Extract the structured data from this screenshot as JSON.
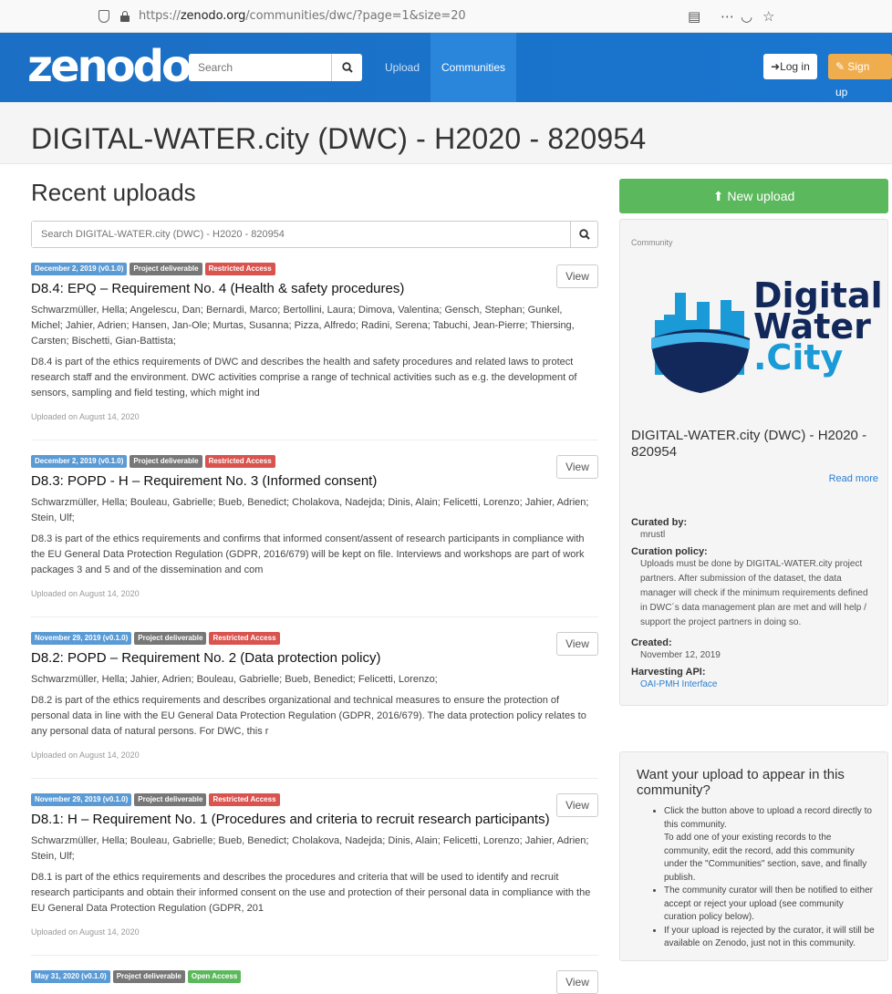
{
  "browser": {
    "url_prefix": "https://",
    "url_domain": "zenodo.org",
    "url_path": "/communities/dwc/?page=1&size=20"
  },
  "header": {
    "logo": "zenodo",
    "search_placeholder": "Search",
    "nav_upload": "Upload",
    "nav_communities": "Communities",
    "login": "Log in",
    "signup": "Sign up"
  },
  "page_title": "DIGITAL-WATER.city (DWC) - H2020 - 820954",
  "main": {
    "heading": "Recent uploads",
    "search_placeholder": "Search DIGITAL-WATER.city (DWC) - H2020 - 820954",
    "view_label": "View",
    "records": [
      {
        "date_badge": "December 2, 2019 (v0.1.0)",
        "type_badge": "Project deliverable",
        "access_badge": "Restricted Access",
        "title": "D8.4: EPQ – Requirement No. 4 (Health & safety procedures)",
        "authors": "Schwarzmüller, Hella; Angelescu, Dan; Bernardi, Marco; Bertollini, Laura; Dimova, Valentina; Gensch, Stephan; Gunkel, Michel; Jahier, Adrien; Hansen, Jan-Ole; Murtas, Susanna; Pizza, Alfredo; Radini, Serena; Tabuchi, Jean-Pierre; Thiersing, Carsten; Bischetti, Gian-Battista;",
        "description": "D8.4 is part of the ethics requirements of DWC and describes the health and safety procedures and related laws to protect research staff and the environment. DWC activities comprise a range of technical activities such as e.g. the development of sensors, sampling and field testing, which might ind",
        "uploaded": "Uploaded on August 14, 2020"
      },
      {
        "date_badge": "December 2, 2019 (v0.1.0)",
        "type_badge": "Project deliverable",
        "access_badge": "Restricted Access",
        "title": "D8.3: POPD - H – Requirement No. 3 (Informed consent)",
        "authors": "Schwarzmüller, Hella; Bouleau, Gabrielle; Bueb, Benedict; Cholakova, Nadejda; Dinis, Alain; Felicetti, Lorenzo; Jahier, Adrien; Stein, Ulf;",
        "description": "D8.3 is part of the ethics requirements and confirms that informed consent/assent of research participants in compliance with the EU General Data Protection Regulation (GDPR, 2016/679) will be kept on file. Interviews and workshops are part of work packages 3 and 5 and of the dissemination and com",
        "uploaded": "Uploaded on August 14, 2020"
      },
      {
        "date_badge": "November 29, 2019 (v0.1.0)",
        "type_badge": "Project deliverable",
        "access_badge": "Restricted Access",
        "title": "D8.2: POPD – Requirement No. 2 (Data protection policy)",
        "authors": "Schwarzmüller, Hella; Jahier, Adrien; Bouleau, Gabrielle; Bueb, Benedict; Felicetti, Lorenzo;",
        "description": "D8.2 is part of the ethics requirements and describes organizational and technical measures to ensure the protection of personal data in line with the EU General Data Protection Regulation (GDPR, 2016/679). The data protection policy relates to any personal data of natural persons. For DWC, this r",
        "uploaded": "Uploaded on August 14, 2020"
      },
      {
        "date_badge": "November 29, 2019 (v0.1.0)",
        "type_badge": "Project deliverable",
        "access_badge": "Restricted Access",
        "title": "D8.1: H – Requirement No. 1 (Procedures and criteria to recruit research participants)",
        "authors": "Schwarzmüller, Hella; Bouleau, Gabrielle; Bueb, Benedict; Cholakova, Nadejda; Dinis, Alain; Felicetti, Lorenzo; Jahier, Adrien; Stein, Ulf;",
        "description": "D8.1 is part of the ethics requirements and describes the procedures and criteria that will be used to identify and recruit research participants and obtain their informed consent on the use and protection of their personal data in compliance with the EU General Data Protection Regulation (GDPR, 201",
        "uploaded": "Uploaded on August 14, 2020"
      },
      {
        "date_badge": "May 31, 2020 (v0.1.0)",
        "type_badge": "Project deliverable",
        "access_badge": "Open Access"
      }
    ]
  },
  "sidebar": {
    "new_upload": "New upload",
    "community_label": "Community",
    "logo_line1": "Digital",
    "logo_line2": "Water",
    "logo_line3": ".City",
    "community_name": "DIGITAL-WATER.city (DWC) - H2020 - 820954",
    "read_more": "Read more",
    "curated_by_label": "Curated by:",
    "curated_by": "mrustl",
    "policy_label": "Curation policy:",
    "policy": "Uploads must be done by DIGITAL-WATER.city project partners. After submission of the dataset, the data manager will check if the minimum requirements defined in DWC´s data management plan are met and will help / support the project partners in doing so.",
    "created_label": "Created:",
    "created": "November 12, 2019",
    "api_label": "Harvesting API:",
    "api": "OAI-PMH Interface",
    "want_title": "Want your upload to appear in this community?",
    "want_items": [
      "Click the button above to upload a record directly to this community.",
      "To add one of your existing records to the community, edit the record, add this community under the \"Communities\" section, save, and finally publish.",
      "The community curator will then be notified to either accept or reject your upload (see community curation policy below).",
      "If your upload is rejected by the curator, it will still be available on Zenodo, just not in this community."
    ]
  },
  "colors": {
    "header_blue": "#1b6fc4",
    "success_green": "#5cb85c",
    "danger_red": "#d9534f",
    "link_blue": "#2a7fd3"
  }
}
